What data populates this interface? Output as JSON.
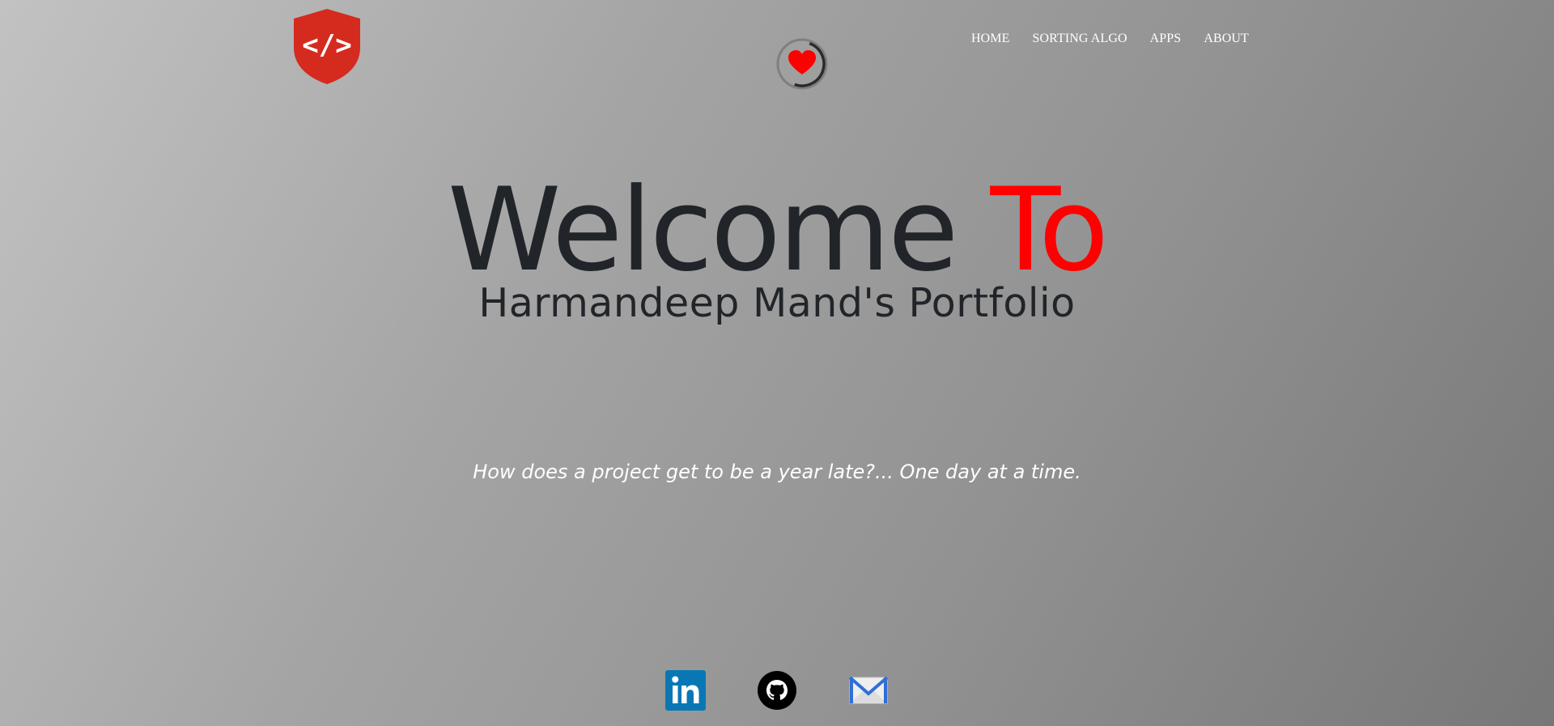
{
  "logo": {
    "icon": "code-shield-icon",
    "glyph": "</>",
    "color": "#d52b1e"
  },
  "heart_badge": {
    "icon": "heart-icon",
    "color": "#ff0000"
  },
  "nav": {
    "items": [
      {
        "label": "HOME"
      },
      {
        "label": "SORTING ALGO"
      },
      {
        "label": "APPS"
      },
      {
        "label": "ABOUT"
      }
    ]
  },
  "hero": {
    "title_main": "Welcome ",
    "title_accent": "To",
    "subtitle": "Harmandeep Mand's Portfolio"
  },
  "quote": "How does a project get to be a year late?... One day at a time.",
  "socials": [
    {
      "icon": "linkedin-icon",
      "color": "#0a77b5"
    },
    {
      "icon": "github-icon",
      "color": "#000000"
    },
    {
      "icon": "mail-icon",
      "color": "#2f6fd6"
    }
  ],
  "colors": {
    "accent": "#ff0000",
    "text_dark": "#212529",
    "nav_text": "#ffffff"
  }
}
